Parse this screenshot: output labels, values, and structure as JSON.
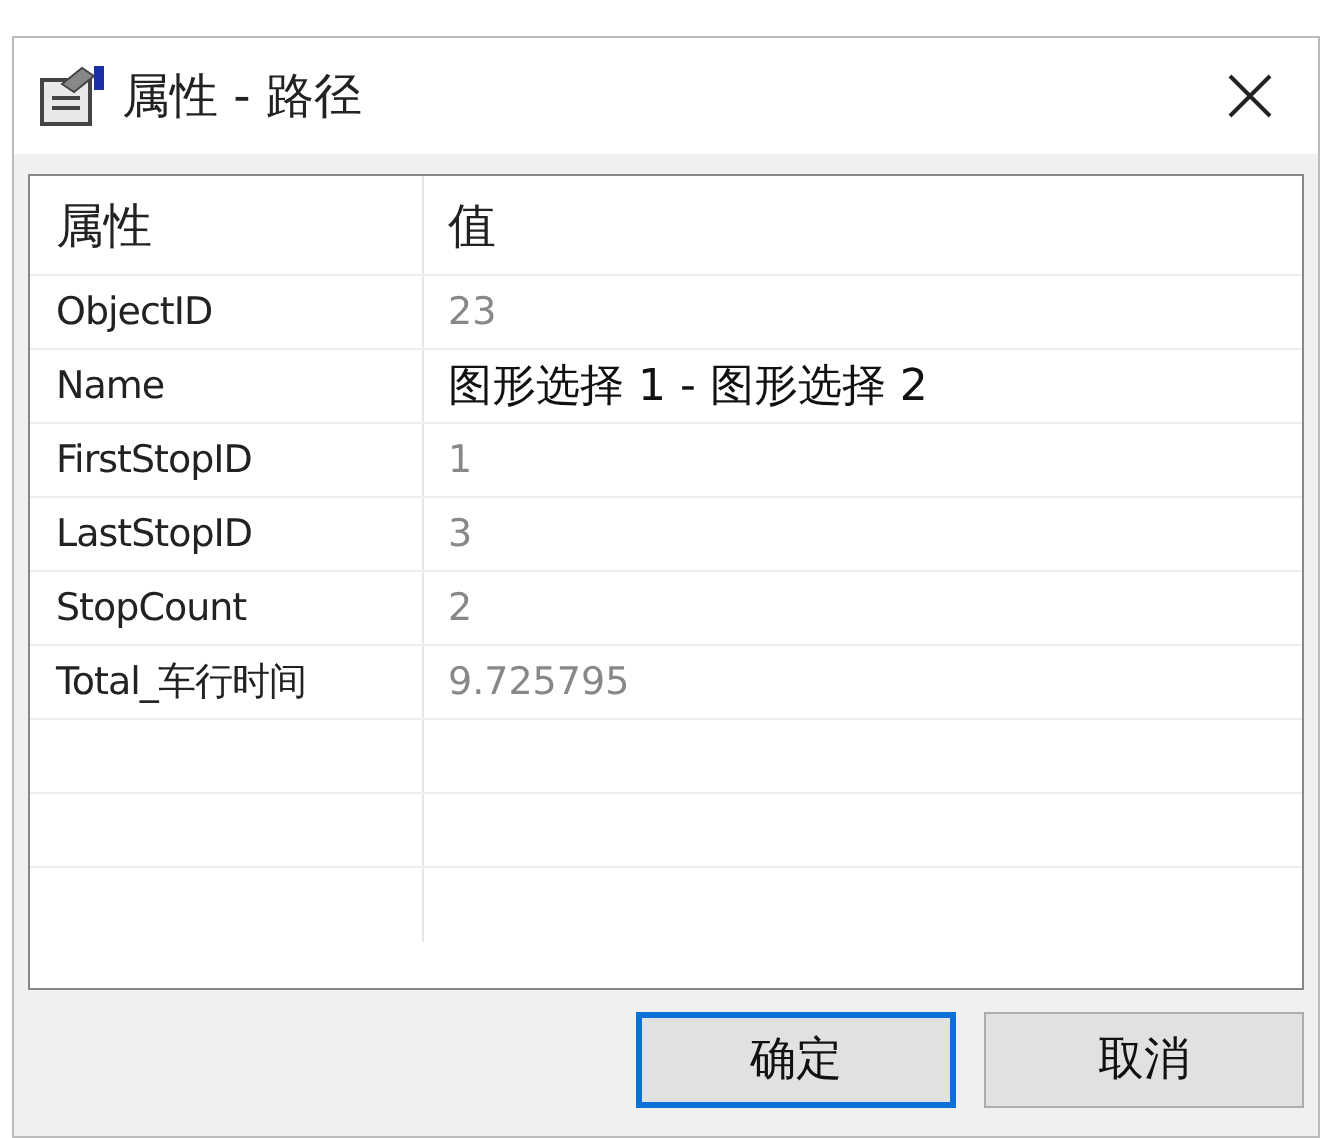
{
  "window": {
    "title": "属性 - 路径"
  },
  "table": {
    "columns": [
      "属性",
      "值"
    ],
    "rows": [
      {
        "name": "ObjectID",
        "value": "23",
        "editable": false
      },
      {
        "name": "Name",
        "value": "图形选择 1 - 图形选择 2",
        "editable": true
      },
      {
        "name": "FirstStopID",
        "value": "1",
        "editable": false
      },
      {
        "name": "LastStopID",
        "value": "3",
        "editable": false
      },
      {
        "name": "StopCount",
        "value": "2",
        "editable": false
      },
      {
        "name": "Total_车行时间",
        "value": "9.725795",
        "editable": false
      }
    ]
  },
  "buttons": [
    {
      "label": "确定",
      "default": true
    },
    {
      "label": "取消",
      "default": false
    }
  ]
}
